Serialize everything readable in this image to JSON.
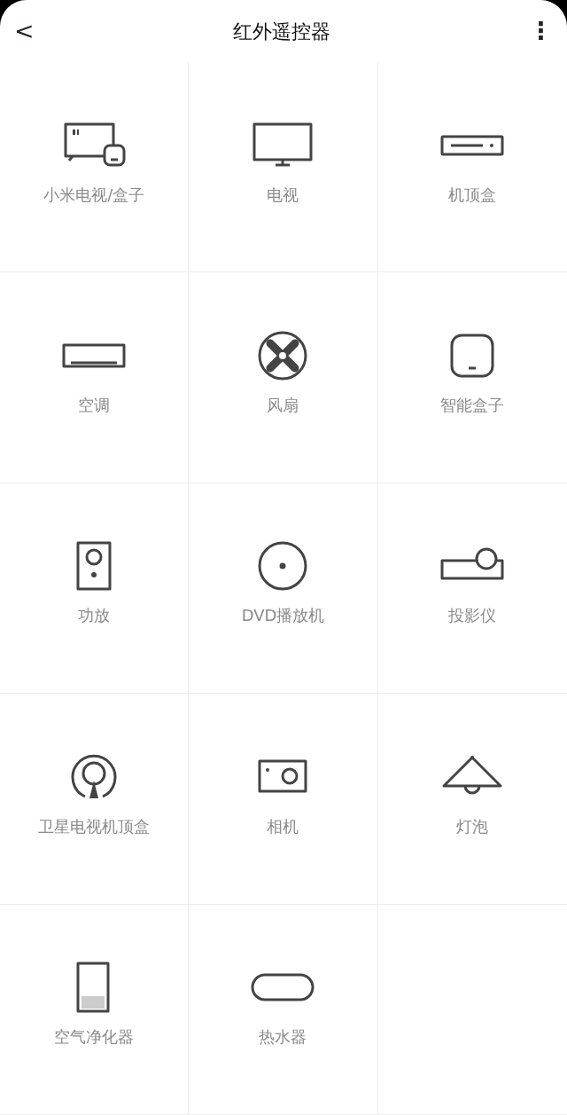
{
  "header": {
    "title": "红外遥控器",
    "back_icon": "<",
    "menu_icon": "⋮"
  },
  "devices": [
    {
      "kind": "mitv",
      "label": "小米电视/盒子"
    },
    {
      "kind": "tv",
      "label": "电视"
    },
    {
      "kind": "settop",
      "label": "机顶盒"
    },
    {
      "kind": "ac",
      "label": "空调"
    },
    {
      "kind": "fan",
      "label": "风扇"
    },
    {
      "kind": "smartbox",
      "label": "智能盒子"
    },
    {
      "kind": "speaker",
      "label": "功放"
    },
    {
      "kind": "dvd",
      "label": "DVD播放机"
    },
    {
      "kind": "projector",
      "label": "投影仪"
    },
    {
      "kind": "satellite",
      "label": "卫星电视机顶盒"
    },
    {
      "kind": "camera",
      "label": "相机"
    },
    {
      "kind": "lamp",
      "label": "灯泡"
    },
    {
      "kind": "purifier",
      "label": "空气净化器"
    },
    {
      "kind": "heater",
      "label": "热水器"
    }
  ]
}
